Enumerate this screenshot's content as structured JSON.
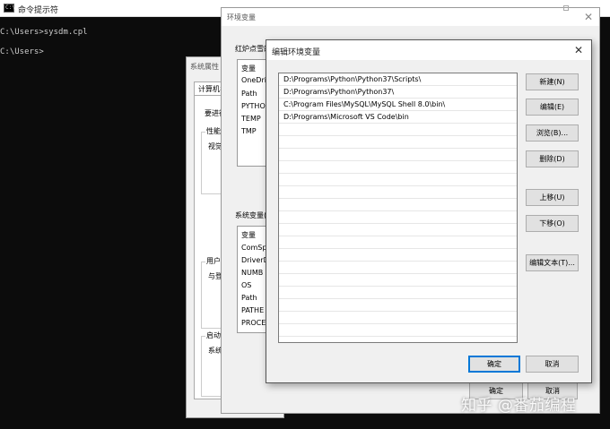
{
  "cmd": {
    "title": "命令提示符",
    "icon": "terminal-icon",
    "lines": [
      "C:\\Users>sysdm.cpl",
      "C:\\Users>"
    ]
  },
  "system_properties": {
    "title": "系统属性",
    "tab": "计算机名",
    "admin_text": "要进行",
    "performance_label": "性能",
    "visual_text": "视觉",
    "user_profile_label": "用户配",
    "login_text": "与登",
    "startup_label": "启动",
    "system_text": "系统"
  },
  "env_vars": {
    "title": "环境变量",
    "user_group_label": "红炉点雪的",
    "user_header": "变量",
    "user_vars": [
      "OneDri",
      "Path",
      "PYTHO",
      "TEMP",
      "TMP"
    ],
    "system_group_label": "系统变量(",
    "system_header": "变量",
    "system_vars": [
      "ComSp",
      "DriverD",
      "NUMB",
      "OS",
      "Path",
      "PATHE",
      "PROCE"
    ],
    "ok_label": "确定",
    "cancel_label": "取消"
  },
  "edit_env": {
    "title": "编辑环境变量",
    "paths": [
      "D:\\Programs\\Python\\Python37\\Scripts\\",
      "D:\\Programs\\Python\\Python37\\",
      "C:\\Program Files\\MySQL\\MySQL Shell 8.0\\bin\\",
      "D:\\Programs\\Microsoft VS Code\\bin"
    ],
    "buttons": {
      "new": "新建(N)",
      "edit": "编辑(E)",
      "browse": "浏览(B)...",
      "delete": "删除(D)",
      "move_up": "上移(U)",
      "move_down": "下移(O)",
      "edit_text": "编辑文本(T)..."
    },
    "ok_label": "确定",
    "cancel_label": "取消"
  },
  "watermark": "知乎 @番茄编程"
}
